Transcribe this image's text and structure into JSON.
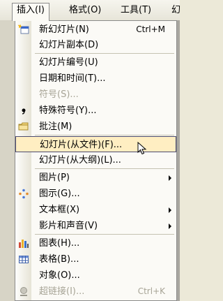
{
  "menubar": {
    "items": [
      {
        "label": "插入(I)",
        "active": true
      },
      {
        "label": "格式(O)"
      },
      {
        "label": "工具(T)"
      },
      {
        "label": "幻"
      }
    ]
  },
  "menu": {
    "items": [
      {
        "id": "new-slide",
        "label": "新幻灯片(N)",
        "shortcut": "Ctrl+M",
        "icon": "new-slide-icon"
      },
      {
        "id": "duplicate-slide",
        "label": "幻灯片副本(D)"
      },
      {
        "id": "slide-number",
        "label": "幻灯片编号(U)"
      },
      {
        "id": "date-time",
        "label": "日期和时间(T)..."
      },
      {
        "id": "symbol",
        "label": "符号(S)...",
        "disabled": true
      },
      {
        "id": "special-symbol",
        "label": "特殊符号(Y)...",
        "icon": "special-symbol-icon"
      },
      {
        "id": "comment",
        "label": "批注(M)",
        "icon": "comment-icon"
      },
      {
        "id": "slides-from-file",
        "label": "幻灯片(从文件)(F)...",
        "highlighted": true
      },
      {
        "id": "slides-from-outline",
        "label": "幻灯片(从大纲)(L)..."
      },
      {
        "id": "picture",
        "label": "图片(P)",
        "submenu": true
      },
      {
        "id": "diagram",
        "label": "图示(G)...",
        "icon": "diagram-icon"
      },
      {
        "id": "text-box",
        "label": "文本框(X)",
        "submenu": true
      },
      {
        "id": "movies-sounds",
        "label": "影片和声音(V)",
        "submenu": true
      },
      {
        "id": "chart",
        "label": "图表(H)...",
        "icon": "chart-icon"
      },
      {
        "id": "table",
        "label": "表格(B)...",
        "icon": "table-icon"
      },
      {
        "id": "object",
        "label": "对象(O)..."
      },
      {
        "id": "hyperlink",
        "label": "超链接(I)...",
        "shortcut": "Ctrl+K",
        "disabled": true,
        "icon": "hyperlink-icon"
      }
    ]
  }
}
